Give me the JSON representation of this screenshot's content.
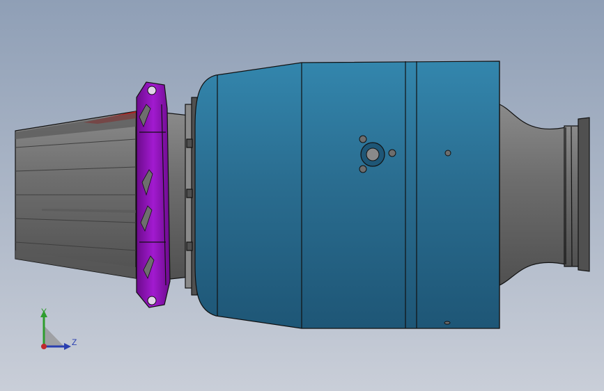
{
  "viewport": {
    "background_top": "#8f9fb6",
    "background_bottom": "#c9ced8"
  },
  "model": {
    "body_color": "#2a6d90",
    "body_highlight": "#3386ad",
    "body_shadow": "#1e5676",
    "metal_color": "#6e6e6e",
    "metal_dark": "#505050",
    "metal_light": "#8a8a8a",
    "bracket_color": "#a21ad0",
    "bracket_dark": "#6c0b8c",
    "accent_red": "#b82020",
    "edge_color": "#111111"
  },
  "triad": {
    "y_label": "Y",
    "z_label": "Z",
    "y_color": "#2e9d2e",
    "z_color": "#2a3fb0",
    "x_color": "#c0282d",
    "plane_color": "#909090"
  }
}
